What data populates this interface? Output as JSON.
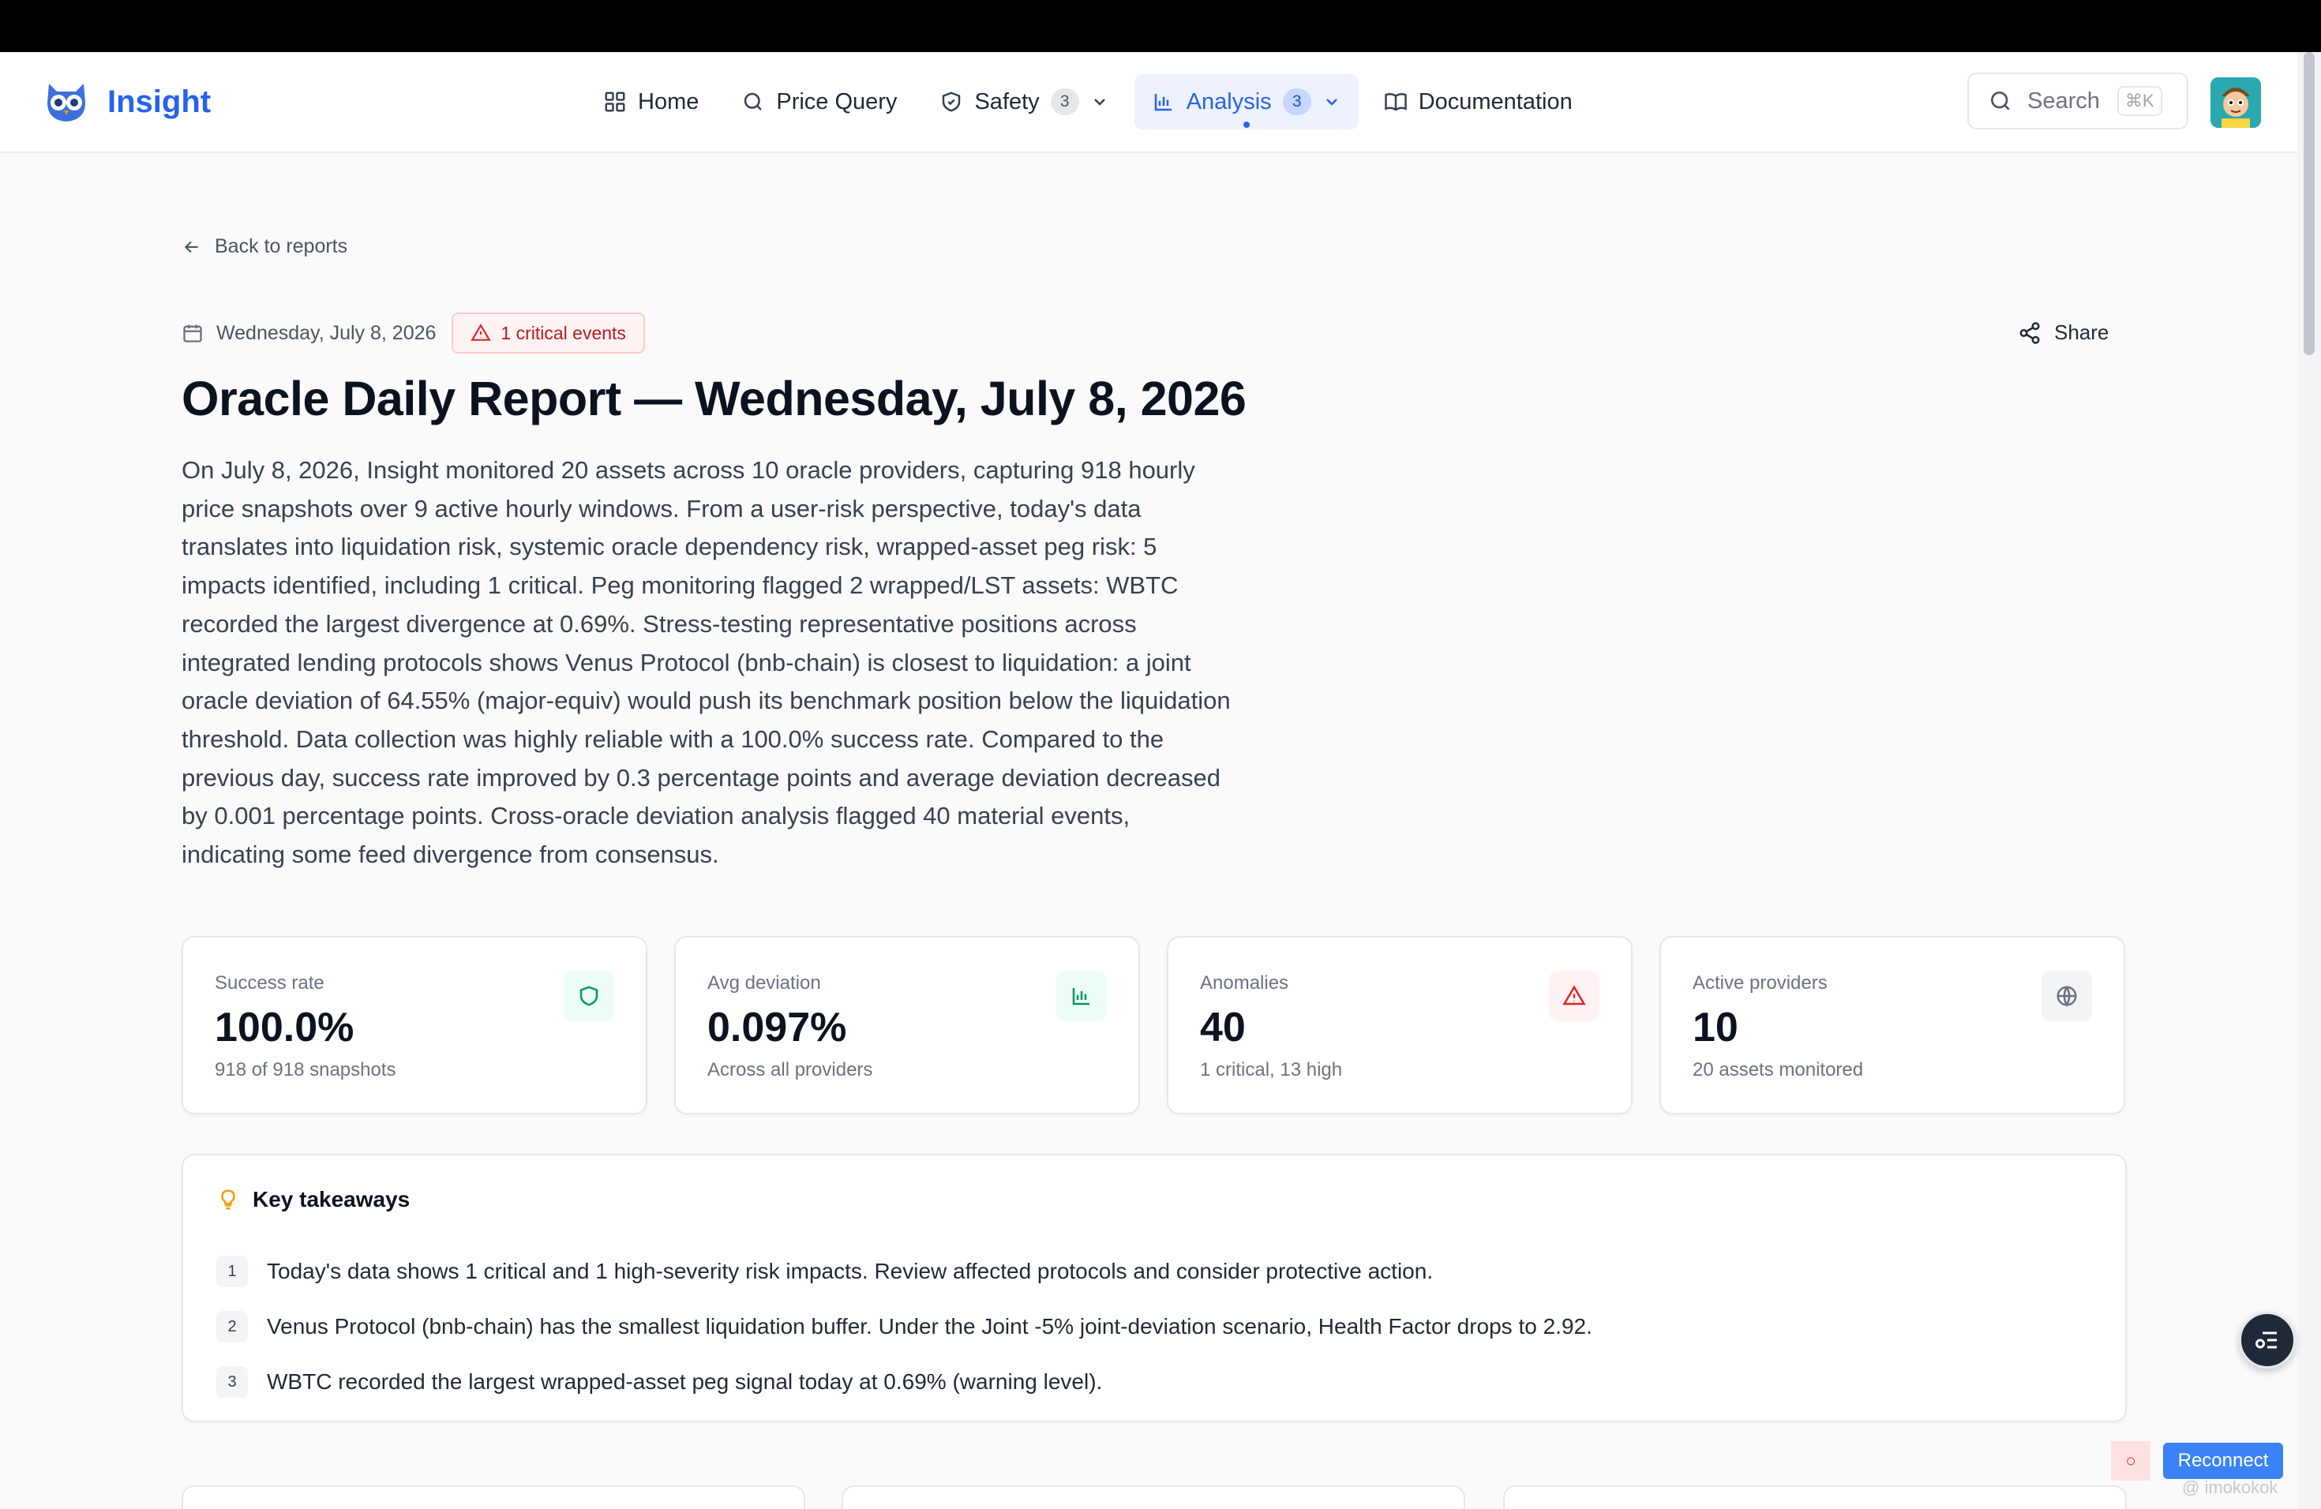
{
  "app": {
    "name": "Insight"
  },
  "nav": {
    "home": "Home",
    "price_query": "Price Query",
    "safety": "Safety",
    "safety_count": "3",
    "analysis": "Analysis",
    "analysis_count": "3",
    "documentation": "Documentation"
  },
  "search": {
    "label": "Search",
    "shortcut": "⌘K"
  },
  "back_link": "Back to reports",
  "report": {
    "date": "Wednesday, July 8, 2026",
    "critical_badge": "1 critical events",
    "share_label": "Share",
    "title": "Oracle Daily Report — Wednesday, July 8, 2026",
    "summary": "On July 8, 2026, Insight monitored 20 assets across 10 oracle providers, capturing 918 hourly price snapshots over 9 active hourly windows. From a user-risk perspective, today's data translates into liquidation risk, systemic oracle dependency risk, wrapped-asset peg risk: 5 impacts identified, including 1 critical. Peg monitoring flagged 2 wrapped/LST assets: WBTC recorded the largest divergence at 0.69%. Stress-testing representative positions across integrated lending protocols shows Venus Protocol (bnb-chain) is closest to liquidation: a joint oracle deviation of 64.55% (major-equiv) would push its benchmark position below the liquidation threshold. Data collection was highly reliable with a 100.0% success rate. Compared to the previous day, success rate improved by 0.3 percentage points and average deviation decreased by 0.001 percentage points. Cross-oracle deviation analysis flagged 40 material events, indicating some feed divergence from consensus."
  },
  "stats": [
    {
      "label": "Success rate",
      "value": "100.0%",
      "sub": "918 of 918 snapshots",
      "icon": "shield-icon",
      "color": "#059669"
    },
    {
      "label": "Avg deviation",
      "value": "0.097%",
      "sub": "Across all providers",
      "icon": "bar-chart-icon",
      "color": "#059669"
    },
    {
      "label": "Anomalies",
      "value": "40",
      "sub": "1 critical, 13 high",
      "icon": "warning-icon",
      "color": "#dc2626"
    },
    {
      "label": "Active providers",
      "value": "10",
      "sub": "20 assets monitored",
      "icon": "globe-icon",
      "color": "#6b7280"
    }
  ],
  "takeaways": {
    "title": "Key takeaways",
    "items": [
      {
        "num": "1",
        "text": "Today's data shows 1 critical and 1 high-severity risk impacts. Review affected protocols and consider protective action."
      },
      {
        "num": "2",
        "text": "Venus Protocol (bnb-chain) has the smallest liquidation buffer. Under the Joint -5% joint-deviation scenario, Health Factor drops to 2.92."
      },
      {
        "num": "3",
        "text": "WBTC recorded the largest wrapped-asset peg signal today at 0.69% (warning level)."
      }
    ]
  },
  "connection": {
    "status_glyph": "○",
    "reconnect_label": "Reconnect",
    "watermark": "@ imokokok"
  },
  "colors": {
    "brand": "#2563eb",
    "critical": "#b91c1c",
    "success": "#059669"
  }
}
